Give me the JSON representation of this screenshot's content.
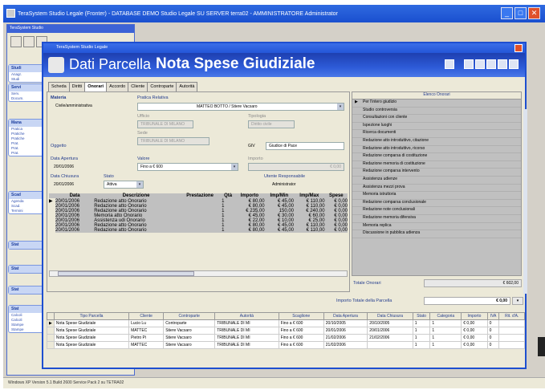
{
  "outer_window": {
    "title": "TeraSystem Studio Legale (Fronter) - DATABASE DEMO Studio Legale SU SERVER terra02 - AMMINISTRATORE Administrator",
    "status_text": "Windows XP Version 5.1 Build 2600 Service Pack 2 su TETRA02"
  },
  "back_window": {
    "title": "TeraSystem Studio",
    "groups": [
      {
        "header": "Studi",
        "items": [
          "Anagr.",
          "Studi"
        ]
      },
      {
        "header": "Servi",
        "items": [
          "Serv.",
          "Docum."
        ]
      },
      {
        "header": "Mana",
        "items": [
          "Pratica",
          "Pratiche",
          "Pratiche",
          "Prat.",
          "Prat.",
          "Prat."
        ]
      },
      {
        "header": "Scad",
        "items": [
          "Agenda",
          "Scad.",
          "Termini"
        ]
      },
      {
        "header": "Stat",
        "items": []
      },
      {
        "header": "Stat",
        "items": []
      },
      {
        "header": "Stat",
        "items": []
      },
      {
        "header": "Stat",
        "items": [
          "Calcoli",
          "Calcoli",
          "Stampe",
          "Stampe"
        ]
      }
    ]
  },
  "dialog": {
    "title": "TeraSystem Studio Legale",
    "header_left": "Dati Parcella",
    "header_main": "Nota Spese Giudiziale"
  },
  "tabs": [
    "Scheda",
    "Diritti",
    "Onorari",
    "Accordo",
    "Cliente",
    "Controparte",
    "Autorità"
  ],
  "form": {
    "materia_label": "Materia",
    "materia_value": "Civile/amministrativa",
    "pratica_label": "Pratica Relativa",
    "pratica_value": "MATTEO BOTTO / Stiere Vacsaro",
    "ufficio_label": "Ufficio",
    "ufficio_value": "TRIBUNALE DI MILANO",
    "tipologia_label": "Tipologia",
    "tipologia_value": "Diritto civile",
    "sede_label": "Sede",
    "sede_value": "TRIBUNALE DI MILANO",
    "oggetto_label": "Oggetto",
    "gdp_label": "Giudice di Pace",
    "gdp_code": "GIV",
    "data_apertura_label": "Data Apertura",
    "data_apertura_value": "20/01/2006",
    "valore_label": "Valore",
    "valore_value": "Fino a € 600",
    "importo_label": "Importo",
    "importo_value": "€ 0,00",
    "data_chiusura_label": "Data Chiusura",
    "data_chiusura_value": "20/01/2006",
    "stato_label": "Stato",
    "stato_value": "Attiva",
    "utente_label": "Utente Responsabile",
    "utente_value": "Administrator"
  },
  "onorari_table": {
    "columns": [
      "Data",
      "Descrizione",
      "Prestazione",
      "Qtà",
      "Importo",
      "Imp/Min",
      "Imp/Max",
      "Spese"
    ],
    "rows": [
      [
        "20/01/2006",
        "Redazione atto Onorario",
        "",
        "1",
        "€ 80,00",
        "€ 45,00",
        "€ 110,00",
        "€ 0,00"
      ],
      [
        "20/01/2006",
        "Redazione atto Onorario",
        "",
        "1",
        "€ 80,00",
        "€ 45,00",
        "€ 110,00",
        "€ 0,00"
      ],
      [
        "20/01/2006",
        "Redazione atto Onorario",
        "",
        "1",
        "€ 235,00",
        "150,00",
        "€ 240,00",
        "€ 0,00"
      ],
      [
        "20/01/2006",
        "Memoria atto Onorario",
        "",
        "1",
        "€ 45,00",
        "€ 30,00",
        "€ 60,00",
        "€ 0,00"
      ],
      [
        "20/01/2006",
        "Assistenza udi Onorario",
        "",
        "1",
        "€ 22,00",
        "€ 10,00",
        "€ 25,00",
        "€ 0,00"
      ],
      [
        "20/01/2006",
        "Redazione atto Onorario",
        "",
        "1",
        "€ 80,00",
        "€ 45,00",
        "€ 110,00",
        "€ 0,00"
      ],
      [
        "20/01/2006",
        "Redazione atto Onorario",
        "",
        "1",
        "€ 80,00",
        "€ 45,00",
        "€ 110,00",
        "€ 0,00"
      ]
    ]
  },
  "elenco": {
    "header": "Elenco Onorari",
    "items": [
      "Per l'intero giudizio",
      "Studio controversia",
      "Consultazioni con cliente",
      "Ispezione luoghi",
      "Ricerca documenti",
      "Redazione atto introduttivo, citazione",
      "Redazione atto introduttivo, ricorso",
      "Redazione comparsa di costituzione",
      "Redazione memoria di costituzione",
      "Redazione comparsa intervento",
      "Assistenza udienze",
      "Assistenza mezzi prova",
      "Memoria istruttoria",
      "Redazione comparsa conclusionale",
      "Redazione note conclusionali",
      "Redazione memoria difensiva",
      "Memoria replica",
      "Discussione in pubblica udienza"
    ]
  },
  "totals": {
    "onorari_label": "Totale Onorari",
    "onorari_value": "€ 602,00",
    "parcella_label": "Importo Totale della Parcella",
    "parcella_value": "€ 0,00"
  },
  "parcelle_table": {
    "columns": [
      "Tipo Parcella",
      "Cliente",
      "Controparte",
      "Autorità",
      "Scaglione",
      "Data Apertura",
      "Data Chiusura",
      "Stato",
      "Categoria",
      "Importo",
      "IVA",
      "Rit. d'A."
    ],
    "rows": [
      [
        "Nota Spese Giudiziale",
        "Lucio Lu",
        "Controparte",
        "TRIBUNALE DI MI",
        "Fino a € 600",
        "20/10/2005",
        "20/10/2005",
        "1",
        "1",
        "€ 0,00",
        "0",
        ""
      ],
      [
        "Nota Spese Giudiziale",
        "MATTEC",
        "Stiere Vacsaro",
        "TRIBUNALE DI MI",
        "Fino a € 600",
        "20/01/2006",
        "20/01/2006",
        "1",
        "1",
        "€ 0,00",
        "0",
        ""
      ],
      [
        "Nota Spese Giudiziale",
        "Pietro Pi",
        "Stiere Vacsaro",
        "TRIBUNALE DI MI",
        "Fino a € 600",
        "21/02/2006",
        "21/02/2006",
        "1",
        "1",
        "€ 0,00",
        "0",
        ""
      ],
      [
        "Nota Spese Giudiziale",
        "MATTEC",
        "Stiere Vacsaro",
        "TRIBUNALE DI MI",
        "Fino a € 600",
        "21/02/2006",
        "",
        "1",
        "1",
        "€ 0,00",
        "0",
        ""
      ]
    ]
  }
}
